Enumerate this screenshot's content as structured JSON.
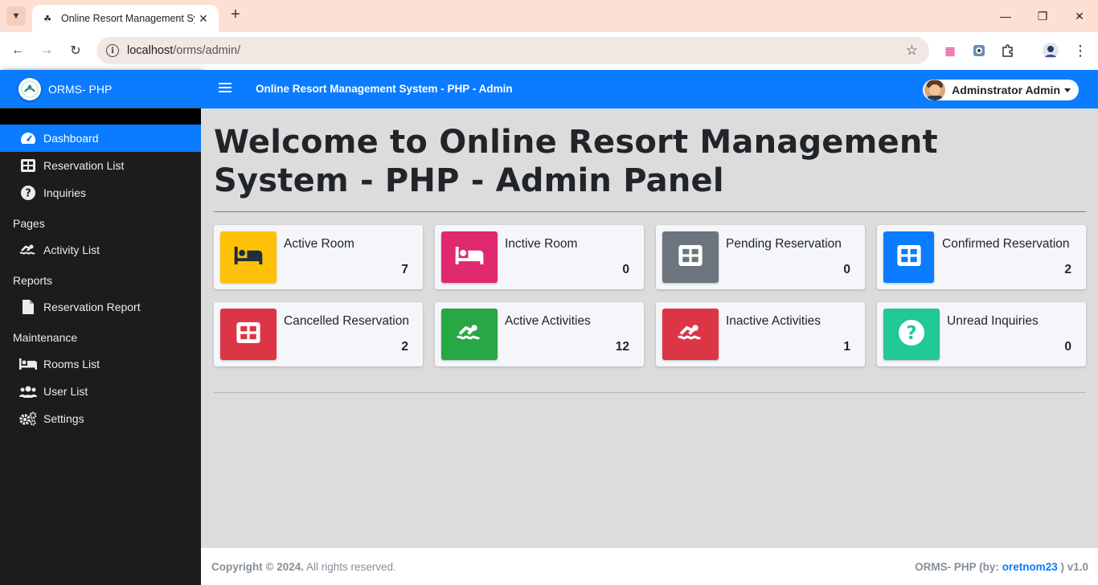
{
  "browser": {
    "tab_title": "Online Resort Management Sys",
    "url_host": "localhost",
    "url_path": "/orms/admin/"
  },
  "sidebar": {
    "brand": "ORMS- PHP",
    "items": [
      {
        "label": "Dashboard",
        "icon": "tachometer-icon",
        "active": true
      },
      {
        "label": "Reservation List",
        "icon": "table-icon"
      },
      {
        "label": "Inquiries",
        "icon": "question-circle-icon"
      }
    ],
    "pages_header": "Pages",
    "pages_items": [
      {
        "label": "Activity List",
        "icon": "swimmer-icon"
      }
    ],
    "reports_header": "Reports",
    "reports_items": [
      {
        "label": "Reservation Report",
        "icon": "file-icon"
      }
    ],
    "maintenance_header": "Maintenance",
    "maintenance_items": [
      {
        "label": "Rooms List",
        "icon": "bed-icon"
      },
      {
        "label": "User List",
        "icon": "users-icon"
      },
      {
        "label": "Settings",
        "icon": "cogs-icon"
      }
    ]
  },
  "topnav": {
    "title": "Online Resort Management System - PHP - Admin",
    "user": "Adminstrator Admin"
  },
  "main": {
    "welcome": "Welcome to Online Resort Management System - PHP - Admin Panel",
    "cards": [
      {
        "label": "Active Room",
        "value": "7",
        "color": "#ffc107",
        "icon": "bed-icon"
      },
      {
        "label": "Inctive Room",
        "value": "0",
        "color": "#e83e8c",
        "icon": "bed-icon"
      },
      {
        "label": "Pending Reservation",
        "value": "0",
        "color": "#6c757d",
        "icon": "table-icon"
      },
      {
        "label": "Confirmed Reservation",
        "value": "2",
        "color": "#0b7bff",
        "icon": "table-icon"
      },
      {
        "label": "Cancelled Reservation",
        "value": "2",
        "color": "#dc3545",
        "icon": "table-icon"
      },
      {
        "label": "Active Activities",
        "value": "12",
        "color": "#28a745",
        "icon": "swimmer-icon"
      },
      {
        "label": "Inactive Activities",
        "value": "1",
        "color": "#dc3545",
        "icon": "swimmer-icon"
      },
      {
        "label": "Unread Inquiries",
        "value": "0",
        "color": "#20c997",
        "icon": "question-circle-icon"
      }
    ]
  },
  "footer": {
    "copyright": "Copyright © 2024.",
    "rights": " All rights reserved.",
    "app": "ORMS- PHP (by: ",
    "author": "oretnom23",
    "version_suffix": " ) v1.0"
  }
}
